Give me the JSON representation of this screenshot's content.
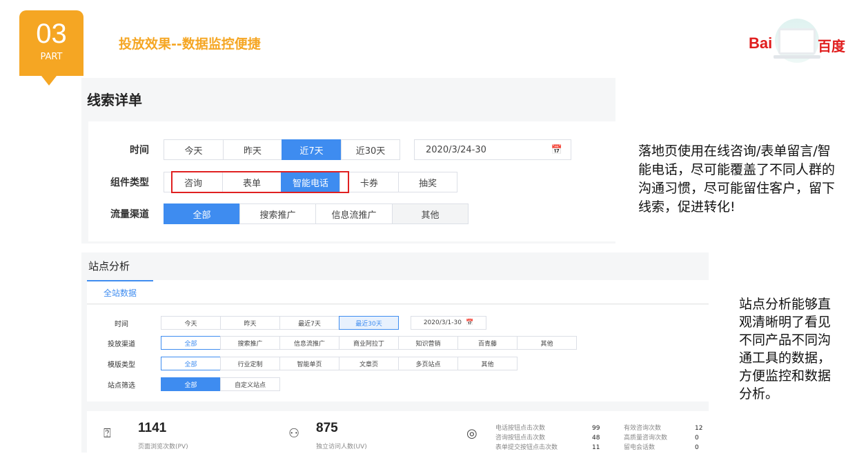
{
  "badge": {
    "number": "03",
    "label": "PART"
  },
  "slide_title": "投放效果--数据监控便捷",
  "logo": {
    "left": "Bai",
    "right": "百度"
  },
  "leads": {
    "title": "线索详单",
    "time_label": "时间",
    "time_options": [
      "今天",
      "昨天",
      "近7天",
      "近30天"
    ],
    "date_value": "2020/3/24-30",
    "component_label": "组件类型",
    "component_options": [
      "咨询",
      "表单",
      "智能电话",
      "卡券",
      "抽奖"
    ],
    "channel_label": "流量渠道",
    "channel_options": [
      "全部",
      "搜索推广",
      "信息流推广",
      "其他"
    ]
  },
  "site": {
    "title": "站点分析",
    "tab": "全站数据",
    "time_label": "时间",
    "time_options": [
      "今天",
      "昨天",
      "最近7天",
      "最近30天"
    ],
    "date_value": "2020/3/1-30",
    "channel_label": "投放渠道",
    "channel_options": [
      "全部",
      "搜索推广",
      "信息流推广",
      "商业阿拉丁",
      "知识营销",
      "百青藤",
      "其他"
    ],
    "template_label": "模版类型",
    "template_options": [
      "全部",
      "行业定制",
      "智能单页",
      "文章页",
      "多页站点",
      "其他"
    ],
    "filter_label": "站点筛选",
    "filter_options": [
      "全部",
      "自定义站点"
    ],
    "pv_value": "1141",
    "pv_label": "页面浏览次数(PV)",
    "uv_value": "875",
    "uv_label": "独立访问人数(UV)",
    "metrics_left": [
      {
        "k": "电话按钮点击次数",
        "v": "99"
      },
      {
        "k": "咨询按钮点击次数",
        "v": "48"
      },
      {
        "k": "表单提交按钮点击次数",
        "v": "11"
      }
    ],
    "metrics_right": [
      {
        "k": "有效咨询次数",
        "v": "12"
      },
      {
        "k": "高质量咨询次数",
        "v": "0"
      },
      {
        "k": "留电会话数",
        "v": "0"
      }
    ]
  },
  "note1": "落地页使用在线咨询/表单留言/智能电话，尽可能覆盖了不同人群的沟通习惯，尽可能留住客户，留下线索，促进转化!",
  "note2": "站点分析能够直观清晰明了看见不同产品不同沟通工具的数据，方便监控和数据分析。",
  "colors": {
    "accent": "#f5a623",
    "primary": "#3e8cf0",
    "highlight_box": "#e02020"
  }
}
